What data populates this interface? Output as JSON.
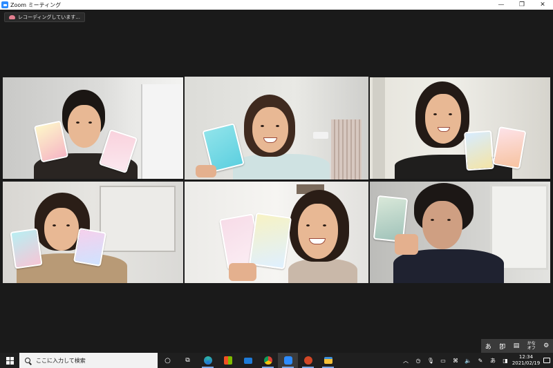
{
  "window": {
    "title": "Zoom ミーティング",
    "minimize": "—",
    "maximize": "❐",
    "close": "✕"
  },
  "recording": {
    "label": "レコーディングしています..."
  },
  "ime": {
    "hiragana": "あ",
    "kanji": "卽",
    "pad": "▤",
    "kana_off": [
      "かな",
      "オフ"
    ],
    "settings": "⚙"
  },
  "taskbar": {
    "search_placeholder": "ここに入力して検索",
    "cortana": "○",
    "task_view": "⧉"
  },
  "tray": {
    "chevron": "︿",
    "hiragana": "あ",
    "time": "12:34",
    "date": "2021/02/19"
  },
  "colors": {
    "active_speaker_border": "#c8e04c",
    "zoom_blue": "#2d8cff",
    "taskbar": "#1f1f1f"
  }
}
